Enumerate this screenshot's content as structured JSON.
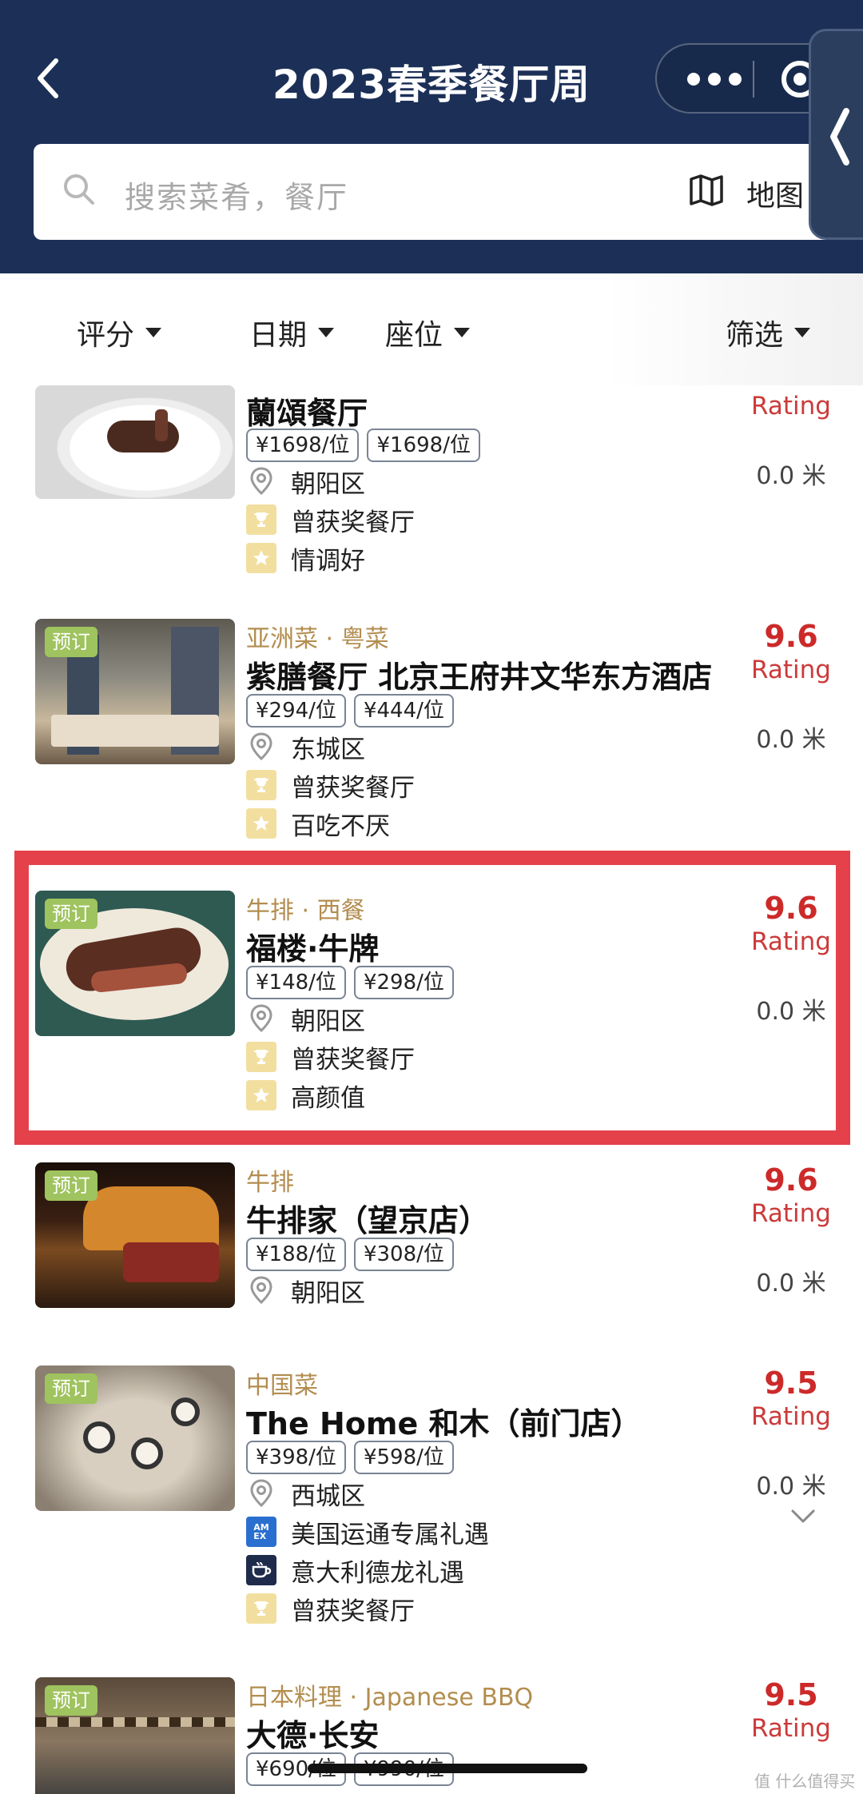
{
  "header": {
    "title": "2023春季餐厅周",
    "search_placeholder": "搜索菜肴，餐厅",
    "map_label": "地图"
  },
  "filters": [
    {
      "label": "评分"
    },
    {
      "label": "日期"
    },
    {
      "label": "座位"
    },
    {
      "label": "筛选"
    }
  ],
  "restaurants": [
    {
      "cuisine": "",
      "name": "蘭頌餐厅",
      "prices": [
        "¥1698/位",
        "¥1698/位"
      ],
      "district": "朝阳区",
      "features": [
        "曾获奖餐厅",
        "情调好"
      ],
      "score": "",
      "rating_label": "Rating",
      "distance": "0.0 米"
    },
    {
      "cuisine": "亚洲菜 · 粤菜",
      "name": "紫膳餐厅 北京王府井文华东方酒店",
      "prices": [
        "¥294/位",
        "¥444/位"
      ],
      "district": "东城区",
      "features": [
        "曾获奖餐厅",
        "百吃不厌"
      ],
      "badge": "预订",
      "score": "9.6",
      "rating_label": "Rating",
      "distance": "0.0 米"
    },
    {
      "cuisine": "牛排 · 西餐",
      "name": "福楼·牛牌",
      "prices": [
        "¥148/位",
        "¥298/位"
      ],
      "district": "朝阳区",
      "features": [
        "曾获奖餐厅",
        "高颜值"
      ],
      "badge": "预订",
      "score": "9.6",
      "rating_label": "Rating",
      "distance": "0.0 米"
    },
    {
      "cuisine": "牛排",
      "name": "牛排家（望京店）",
      "prices": [
        "¥188/位",
        "¥308/位"
      ],
      "district": "朝阳区",
      "features": [],
      "badge": "预订",
      "score": "9.6",
      "rating_label": "Rating",
      "distance": "0.0 米"
    },
    {
      "cuisine": "中国菜",
      "name": "The Home 和木（前门店）",
      "prices": [
        "¥398/位",
        "¥598/位"
      ],
      "district": "西城区",
      "features": [
        "美国运通专属礼遇",
        "意大利德龙礼遇",
        "曾获奖餐厅"
      ],
      "badge": "预订",
      "score": "9.5",
      "rating_label": "Rating",
      "distance": "0.0 米"
    },
    {
      "cuisine": "日本料理 · Japanese BBQ",
      "name": "大德·长安",
      "prices": [
        "¥690/位",
        "¥990/位"
      ],
      "badge": "预订",
      "score": "9.5",
      "rating_label": "Rating"
    }
  ],
  "watermark": "值 什么值得买",
  "colors": {
    "header_bg": "#1c3057",
    "accent_red": "#cc2a2a",
    "highlight_border": "#e5414b",
    "cuisine_gold": "#b38d4f",
    "badge_green": "#9fc35e"
  }
}
